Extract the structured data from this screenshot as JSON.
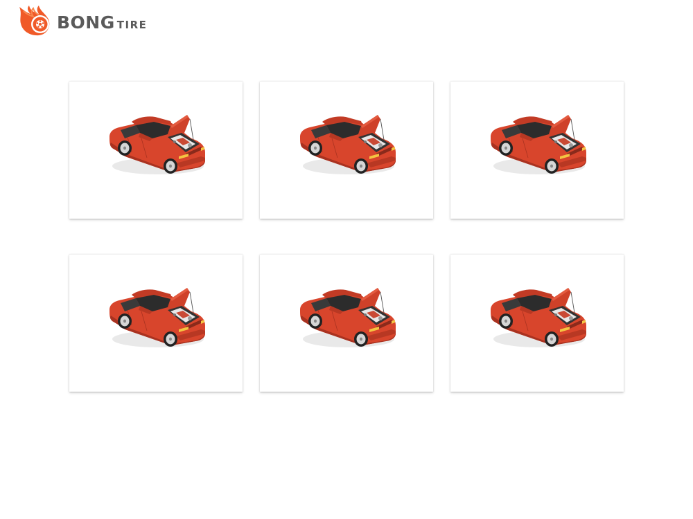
{
  "brand": {
    "name_main": "BONG",
    "name_sub": "TIRE",
    "flame_color": "#f05a28",
    "text_color": "#5a5a5a"
  },
  "cards": [
    {
      "icon": "car-hood-open-icon"
    },
    {
      "icon": "car-hood-open-icon"
    },
    {
      "icon": "car-hood-open-icon"
    },
    {
      "icon": "car-hood-open-icon"
    },
    {
      "icon": "car-hood-open-icon"
    },
    {
      "icon": "car-hood-open-icon"
    }
  ],
  "colors": {
    "car_body": "#d8452c",
    "car_dark": "#a93220",
    "glass": "#2c2c2c",
    "engine": "#e8e8e8"
  }
}
